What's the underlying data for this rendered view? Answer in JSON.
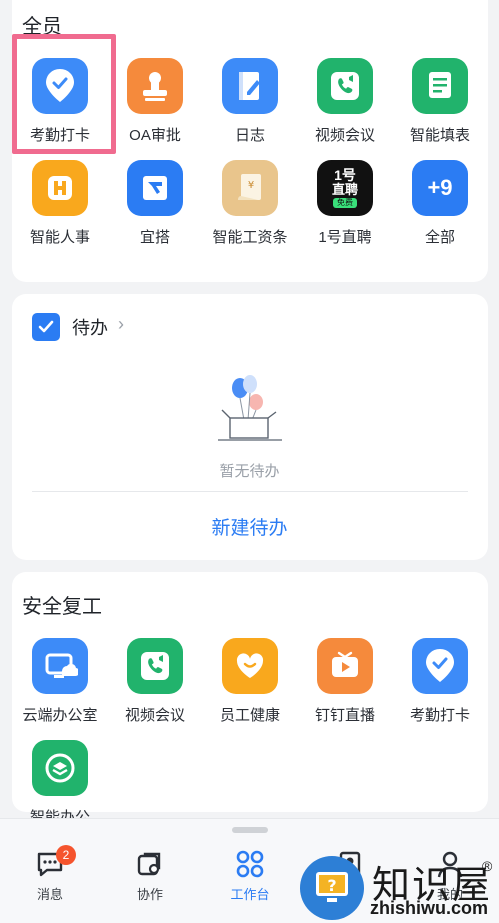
{
  "section1": {
    "title": "全员",
    "apps": [
      {
        "label": "考勤打卡",
        "icon": "location-check-icon",
        "color": "#3d8bf8"
      },
      {
        "label": "OA审批",
        "icon": "stamp-icon",
        "color": "#f58a3c"
      },
      {
        "label": "日志",
        "icon": "notebook-pen-icon",
        "color": "#3d8bf8"
      },
      {
        "label": "视频会议",
        "icon": "video-phone-icon",
        "color": "#21b36c"
      },
      {
        "label": "智能填表",
        "icon": "form-icon",
        "color": "#21b36c"
      },
      {
        "label": "智能人事",
        "icon": "hr-h-icon",
        "color": "#f9a81d"
      },
      {
        "label": "宜搭",
        "icon": "yida-icon",
        "color": "#2b7cf3"
      },
      {
        "label": "智能工资条",
        "icon": "payslip-icon",
        "color": "#e9c58c"
      },
      {
        "label": "1号直聘",
        "icon": "recruit-icon",
        "color": "#111111",
        "icon_text": [
          "1号",
          "直聘",
          "免费"
        ]
      },
      {
        "label": "全部",
        "icon": "plus-nine-icon",
        "color": "#2b7cf3",
        "icon_text": [
          "+9"
        ]
      }
    ]
  },
  "todo": {
    "title": "待办",
    "empty_text": "暂无待办",
    "new_label": "新建待办"
  },
  "section2": {
    "title": "安全复工",
    "apps": [
      {
        "label": "云端办公室",
        "icon": "cloud-monitor-icon",
        "color": "#3d8bf8"
      },
      {
        "label": "视频会议",
        "icon": "video-phone-icon",
        "color": "#21b36c"
      },
      {
        "label": "员工健康",
        "icon": "heart-smile-icon",
        "color": "#f9a81d"
      },
      {
        "label": "钉钉直播",
        "icon": "live-play-icon",
        "color": "#f58a3c"
      },
      {
        "label": "考勤打卡",
        "icon": "location-check-icon",
        "color": "#3d8bf8"
      },
      {
        "label": "智能办公",
        "icon": "layers-icon",
        "color": "#21b36c"
      }
    ]
  },
  "tabbar": {
    "messages": {
      "label": "消息",
      "badge": "2"
    },
    "collab": {
      "label": "协作"
    },
    "workbench": {
      "label": "工作台"
    },
    "contacts": {
      "label": "录"
    },
    "me": {
      "label": "我的"
    }
  },
  "watermark": {
    "text": "知识屋",
    "reg": "®",
    "url": "zhishiwu.com"
  },
  "colors": {
    "accent": "#2b7cf3",
    "badge": "#f5542d",
    "highlight": "#f06b8f"
  }
}
